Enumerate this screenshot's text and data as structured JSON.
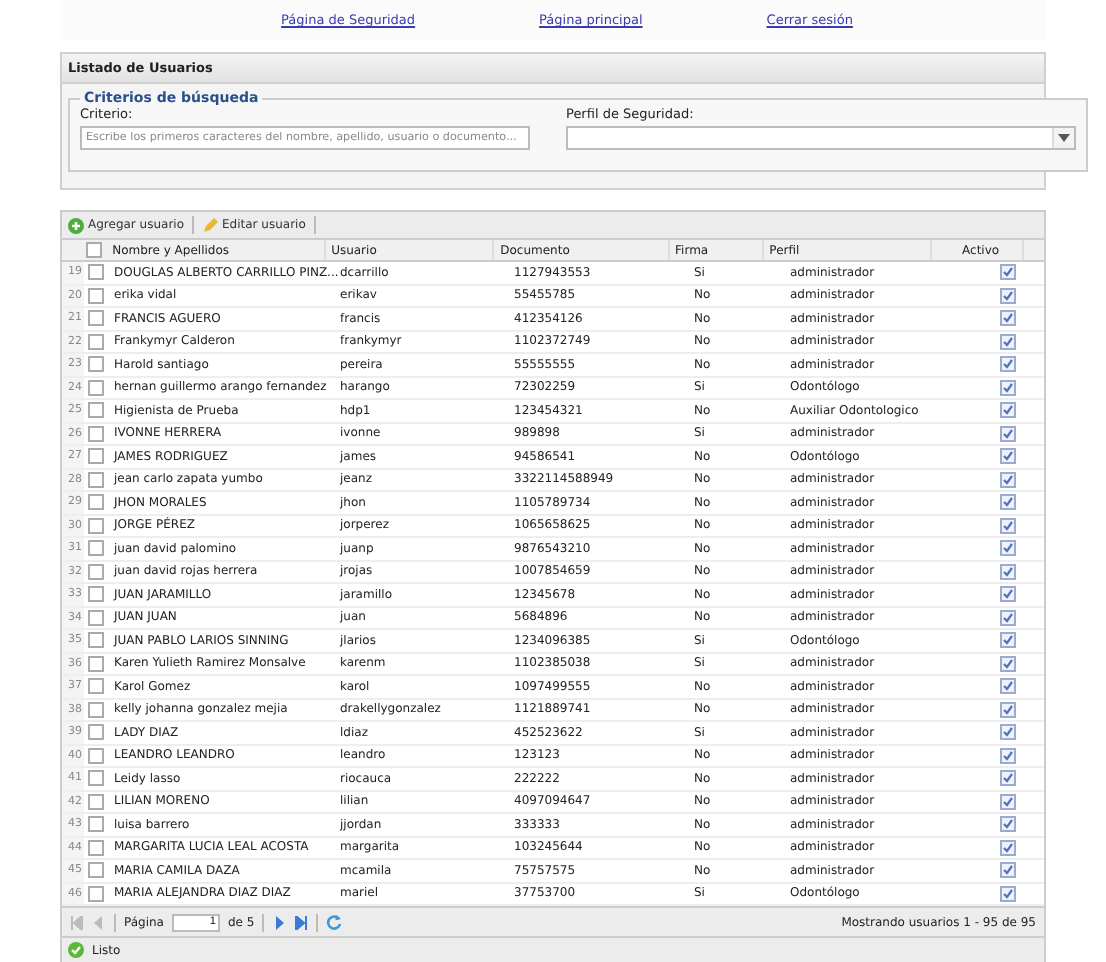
{
  "nav": [
    "Página de Seguridad",
    "Página principal",
    "Cerrar sesión"
  ],
  "panel": {
    "title": "Listado de Usuarios",
    "legend": "Criterios de búsqueda",
    "criterio_label": "Criterio:",
    "criterio_placeholder": "Escribe los primeros caracteres del nombre, apellido, usuario o documento...",
    "perfil_label": "Perfil de Seguridad:"
  },
  "toolbar": [
    "Agregar usuario",
    "Editar usuario"
  ],
  "table": {
    "columns": [
      "Nombre y Apellidos",
      "Usuario",
      "Documento",
      "Firma",
      "Perfil",
      "Activo"
    ],
    "all_selected": false,
    "rows": [
      {
        "num": "19",
        "name": "DOUGLAS ALBERTO CARRILLO PINZ...",
        "user": "dcarrillo",
        "doc": "1127943553",
        "firma": "Si",
        "perfil": "administrador",
        "selected": false,
        "active": true
      },
      {
        "num": "20",
        "name": "erika vidal",
        "user": "erikav",
        "doc": "55455785",
        "firma": "No",
        "perfil": "administrador",
        "selected": false,
        "active": true
      },
      {
        "num": "21",
        "name": "FRANCIS AGUERO",
        "user": "francis",
        "doc": "412354126",
        "firma": "No",
        "perfil": "administrador",
        "selected": false,
        "active": true
      },
      {
        "num": "22",
        "name": "Frankymyr Calderon",
        "user": "frankymyr",
        "doc": "1102372749",
        "firma": "No",
        "perfil": "administrador",
        "selected": false,
        "active": true
      },
      {
        "num": "23",
        "name": "Harold santiago",
        "user": "pereira",
        "doc": "55555555",
        "firma": "No",
        "perfil": "administrador",
        "selected": false,
        "active": true
      },
      {
        "num": "24",
        "name": "hernan guillermo arango fernandez",
        "user": "harango",
        "doc": "72302259",
        "firma": "Si",
        "perfil": "Odontólogo",
        "selected": false,
        "active": true
      },
      {
        "num": "25",
        "name": "Higienista de Prueba",
        "user": "hdp1",
        "doc": "123454321",
        "firma": "No",
        "perfil": "Auxiliar Odontologico",
        "selected": false,
        "active": true
      },
      {
        "num": "26",
        "name": "IVONNE HERRERA",
        "user": "ivonne",
        "doc": "989898",
        "firma": "Si",
        "perfil": "administrador",
        "selected": false,
        "active": true
      },
      {
        "num": "27",
        "name": "JAMES RODRIGUEZ",
        "user": "james",
        "doc": "94586541",
        "firma": "No",
        "perfil": "Odontólogo",
        "selected": false,
        "active": true
      },
      {
        "num": "28",
        "name": "jean carlo zapata yumbo",
        "user": "jeanz",
        "doc": "3322114588949",
        "firma": "No",
        "perfil": "administrador",
        "selected": false,
        "active": true
      },
      {
        "num": "29",
        "name": "JHON MORALES",
        "user": "jhon",
        "doc": "1105789734",
        "firma": "No",
        "perfil": "administrador",
        "selected": false,
        "active": true
      },
      {
        "num": "30",
        "name": "JORGE PÉREZ",
        "user": "jorperez",
        "doc": "1065658625",
        "firma": "No",
        "perfil": "administrador",
        "selected": false,
        "active": true
      },
      {
        "num": "31",
        "name": "juan david palomino",
        "user": "juanp",
        "doc": "9876543210",
        "firma": "No",
        "perfil": "administrador",
        "selected": false,
        "active": true
      },
      {
        "num": "32",
        "name": "juan david rojas herrera",
        "user": "jrojas",
        "doc": "1007854659",
        "firma": "No",
        "perfil": "administrador",
        "selected": false,
        "active": true
      },
      {
        "num": "33",
        "name": "JUAN JARAMILLO",
        "user": "jaramillo",
        "doc": "12345678",
        "firma": "No",
        "perfil": "administrador",
        "selected": false,
        "active": true
      },
      {
        "num": "34",
        "name": "JUAN JUAN",
        "user": "juan",
        "doc": "5684896",
        "firma": "No",
        "perfil": "administrador",
        "selected": false,
        "active": true
      },
      {
        "num": "35",
        "name": "JUAN PABLO LARIOS SINNING",
        "user": "jlarios",
        "doc": "1234096385",
        "firma": "Si",
        "perfil": "Odontólogo",
        "selected": false,
        "active": true
      },
      {
        "num": "36",
        "name": "Karen Yulieth Ramirez Monsalve",
        "user": "karenm",
        "doc": "1102385038",
        "firma": "Si",
        "perfil": "administrador",
        "selected": false,
        "active": true
      },
      {
        "num": "37",
        "name": "Karol Gomez",
        "user": "karol",
        "doc": "1097499555",
        "firma": "No",
        "perfil": "administrador",
        "selected": false,
        "active": true
      },
      {
        "num": "38",
        "name": "kelly johanna gonzalez mejia",
        "user": "drakellygonzalez",
        "doc": "1121889741",
        "firma": "No",
        "perfil": "administrador",
        "selected": false,
        "active": true
      },
      {
        "num": "39",
        "name": "LADY DIAZ",
        "user": "ldiaz",
        "doc": "452523622",
        "firma": "Si",
        "perfil": "administrador",
        "selected": false,
        "active": true
      },
      {
        "num": "40",
        "name": "LEANDRO LEANDRO",
        "user": "leandro",
        "doc": "123123",
        "firma": "No",
        "perfil": "administrador",
        "selected": false,
        "active": true
      },
      {
        "num": "41",
        "name": "Leidy lasso",
        "user": "riocauca",
        "doc": "222222",
        "firma": "No",
        "perfil": "administrador",
        "selected": false,
        "active": true
      },
      {
        "num": "42",
        "name": "LILIAN MORENO",
        "user": "lilian",
        "doc": "4097094647",
        "firma": "No",
        "perfil": "administrador",
        "selected": false,
        "active": true
      },
      {
        "num": "43",
        "name": "luisa barrero",
        "user": "jjordan",
        "doc": "333333",
        "firma": "No",
        "perfil": "administrador",
        "selected": false,
        "active": true
      },
      {
        "num": "44",
        "name": "MARGARITA LUCIA LEAL ACOSTA",
        "user": "margarita",
        "doc": "103245644",
        "firma": "No",
        "perfil": "administrador",
        "selected": false,
        "active": true
      },
      {
        "num": "45",
        "name": "MARIA CAMILA DAZA",
        "user": "mcamila",
        "doc": "75757575",
        "firma": "No",
        "perfil": "administrador",
        "selected": false,
        "active": true
      },
      {
        "num": "46",
        "name": "MARIA ALEJANDRA DIAZ DIAZ",
        "user": "mariel",
        "doc": "37753700",
        "firma": "Si",
        "perfil": "Odontólogo",
        "selected": false,
        "active": true
      }
    ]
  },
  "pager": {
    "page_label": "Página",
    "page": "1",
    "of": "de 5",
    "summary": "Mostrando usuarios 1 - 95 de 95"
  },
  "status": "Listo"
}
